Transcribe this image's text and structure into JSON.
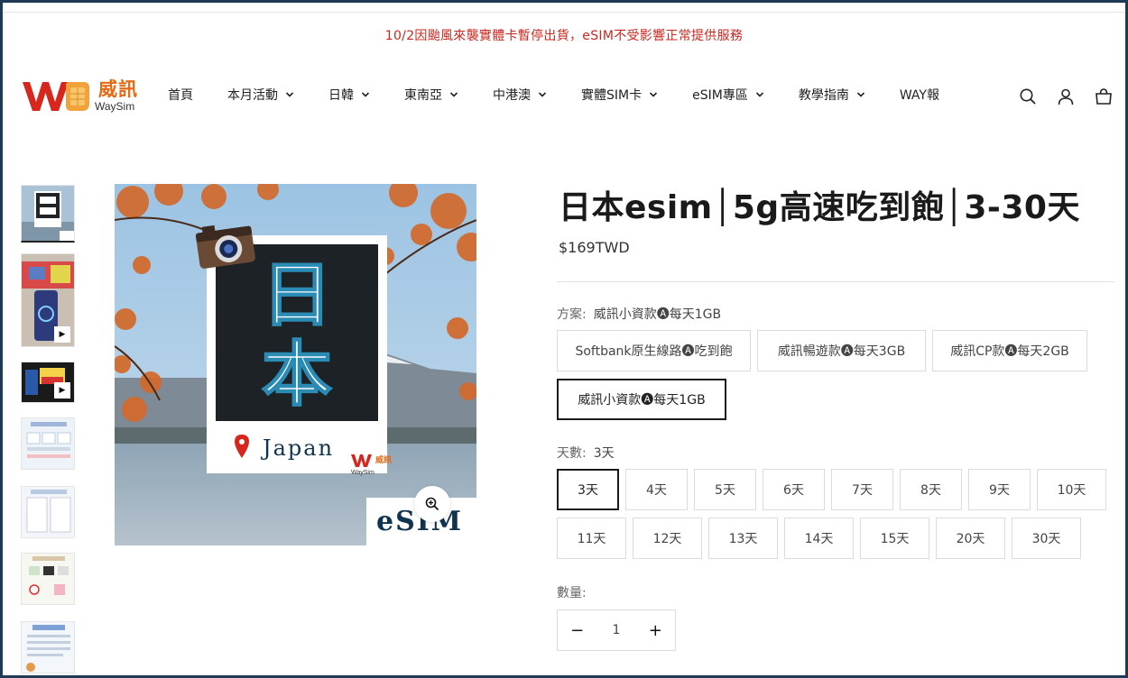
{
  "announcement": "10/2因颱風來襲實體卡暫停出貨，eSIM不受影響正常提供服務",
  "logo": {
    "brand": "威訊",
    "sub": "WaySim",
    "badge_brand": "威訊",
    "badge_sub": "WaySim"
  },
  "nav": [
    {
      "label": "首頁",
      "dropdown": false
    },
    {
      "label": "本月活動",
      "dropdown": true
    },
    {
      "label": "日韓",
      "dropdown": true
    },
    {
      "label": "東南亞",
      "dropdown": true
    },
    {
      "label": "中港澳",
      "dropdown": true
    },
    {
      "label": "實體SIM卡",
      "dropdown": true
    },
    {
      "label": "eSIM專區",
      "dropdown": true
    },
    {
      "label": "教學指南",
      "dropdown": true
    },
    {
      "label": "WAY報",
      "dropdown": false
    }
  ],
  "header_icons": [
    "search-icon",
    "account-icon",
    "cart-icon"
  ],
  "hero": {
    "big_char_1": "日",
    "big_char_2": "本",
    "place": "Japan",
    "tag": "eSIM"
  },
  "product": {
    "title": "日本esim│5g高速吃到飽│3-30天",
    "price": "$169TWD"
  },
  "plan": {
    "label": "方案:",
    "selected": "威訊小資款🅐每天1GB",
    "options": [
      "Softbank原生線路🅐吃到飽",
      "威訊暢遊款🅐每天3GB",
      "威訊CP款🅐每天2GB",
      "威訊小資款🅐每天1GB"
    ]
  },
  "days": {
    "label": "天數:",
    "selected": "3天",
    "options": [
      "3天",
      "4天",
      "5天",
      "6天",
      "7天",
      "8天",
      "9天",
      "10天",
      "11天",
      "12天",
      "13天",
      "14天",
      "15天",
      "20天",
      "30天"
    ]
  },
  "quantity": {
    "label": "數量:",
    "value": "1",
    "minus": "−",
    "plus": "+"
  },
  "colors": {
    "announce": "#c8271f",
    "brand_red": "#d7261e",
    "brand_orange": "#e46a14",
    "navy": "#10334f"
  }
}
